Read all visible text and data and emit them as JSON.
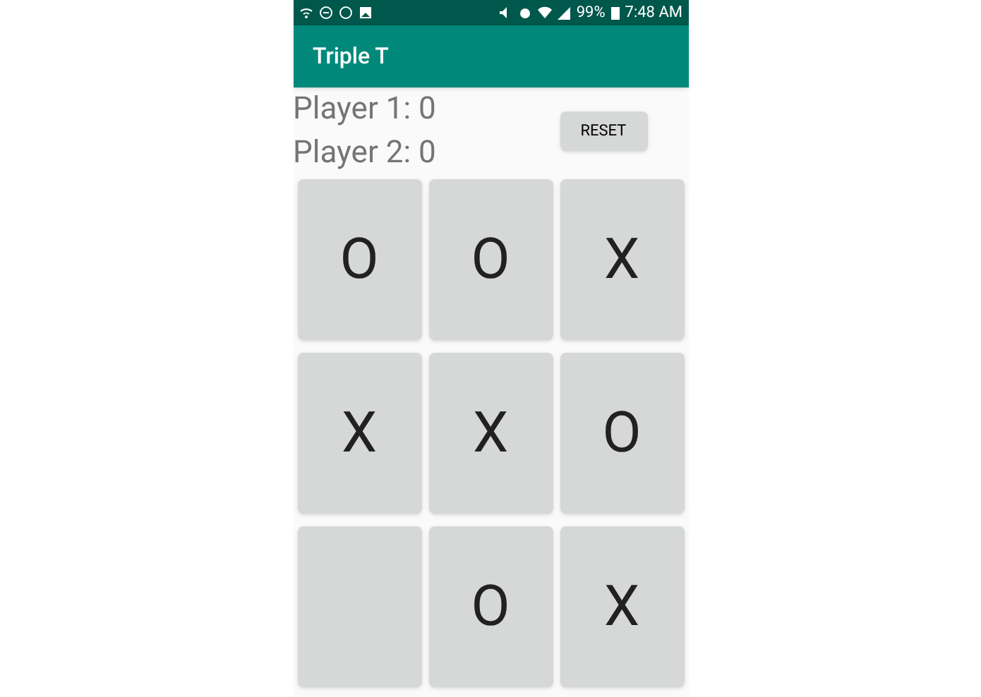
{
  "status_bar": {
    "battery": "99%",
    "time": "7:48 AM"
  },
  "app_bar": {
    "title": "Triple T"
  },
  "scores": [
    "Player 1: 0",
    "Player 2: 0"
  ],
  "reset_button": {
    "label": "RESET"
  },
  "board": [
    {
      "kind": "played",
      "mark": "O"
    },
    {
      "kind": "played",
      "mark": "O"
    },
    {
      "kind": "played",
      "mark": "X"
    },
    {
      "kind": "played",
      "mark": "X"
    },
    {
      "kind": "played",
      "mark": "X"
    },
    {
      "kind": "played",
      "mark": "O"
    },
    {
      "kind": "empty"
    },
    {
      "kind": "played",
      "mark": "O"
    },
    {
      "kind": "played",
      "mark": "X"
    }
  ]
}
